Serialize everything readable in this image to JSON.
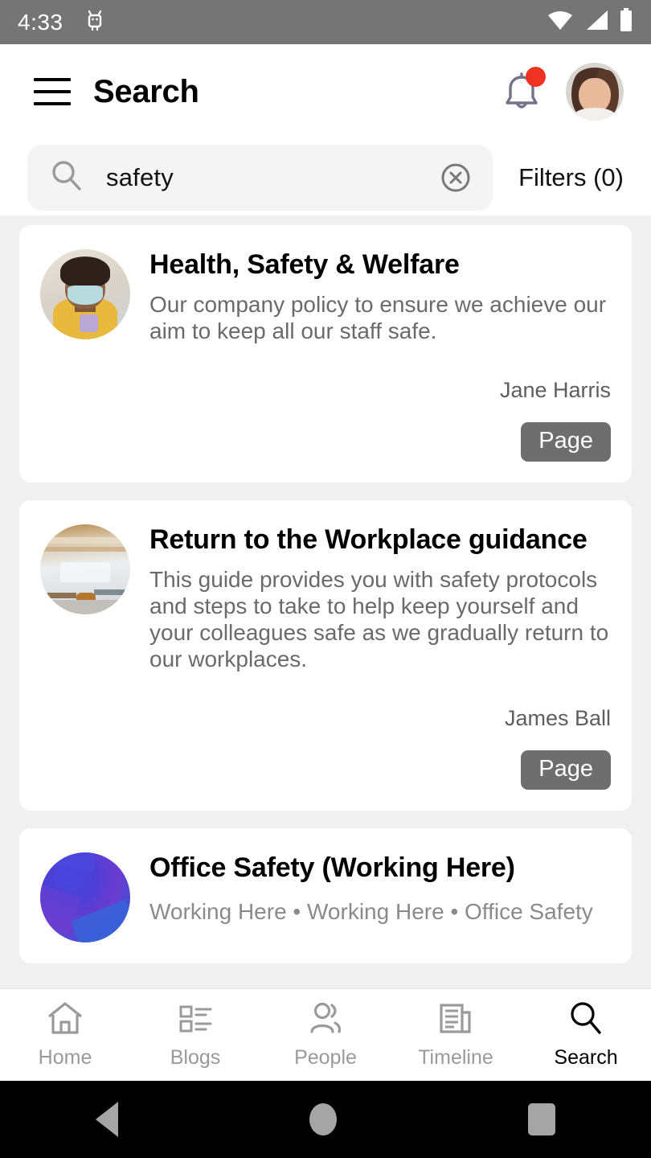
{
  "status_bar": {
    "time": "4:33",
    "left_icons": [
      "android-debug-icon"
    ],
    "right_icons": [
      "wifi-icon",
      "cellular-signal-icon",
      "battery-icon"
    ],
    "background_color": "#757575"
  },
  "app_bar": {
    "menu_icon": "hamburger-menu-icon",
    "title": "Search",
    "notification_icon": "bell-icon",
    "notification_badge": true,
    "notification_badge_color": "#ee3322",
    "avatar": "user-avatar"
  },
  "search": {
    "icon": "search-icon",
    "value": "safety",
    "placeholder": "Search",
    "clear_icon": "clear-circle-icon",
    "filters_label": "Filters (0)",
    "filters_count": 0
  },
  "results": [
    {
      "thumb": "person-with-mask-photo",
      "title": "Health, Safety & Welfare",
      "description": "Our company policy to ensure we achieve our aim to keep all our staff safe.",
      "author": "Jane Harris",
      "badge": "Page"
    },
    {
      "thumb": "open-plan-office-photo",
      "title": "Return to the Workplace guidance",
      "description": "This guide provides you with safety protocols and steps to take to help keep yourself and your colleagues safe as we gradually return to our workplaces.",
      "author": "James Ball",
      "badge": "Page"
    },
    {
      "thumb": "blue-purple-gradient-graphic",
      "title": "Office Safety (Working Here)",
      "breadcrumb": "Working Here  •  Working Here  •  Office Safety"
    }
  ],
  "bottom_nav": {
    "items": [
      {
        "label": "Home",
        "icon": "home-icon",
        "active": false
      },
      {
        "label": "Blogs",
        "icon": "list-icon",
        "active": false
      },
      {
        "label": "People",
        "icon": "people-icon",
        "active": false
      },
      {
        "label": "Timeline",
        "icon": "newspaper-icon",
        "active": false
      },
      {
        "label": "Search",
        "icon": "search-icon",
        "active": true
      }
    ],
    "active_color": "#000000",
    "inactive_color": "#9a9a9a"
  },
  "system_nav": {
    "back": "back-triangle-icon",
    "home": "home-circle-icon",
    "recents": "recents-square-icon"
  },
  "colors": {
    "badge_gray": "#6e6e6e",
    "page_background": "#f0f0f0",
    "card_background": "#ffffff",
    "search_field": "#f4f4f4"
  }
}
